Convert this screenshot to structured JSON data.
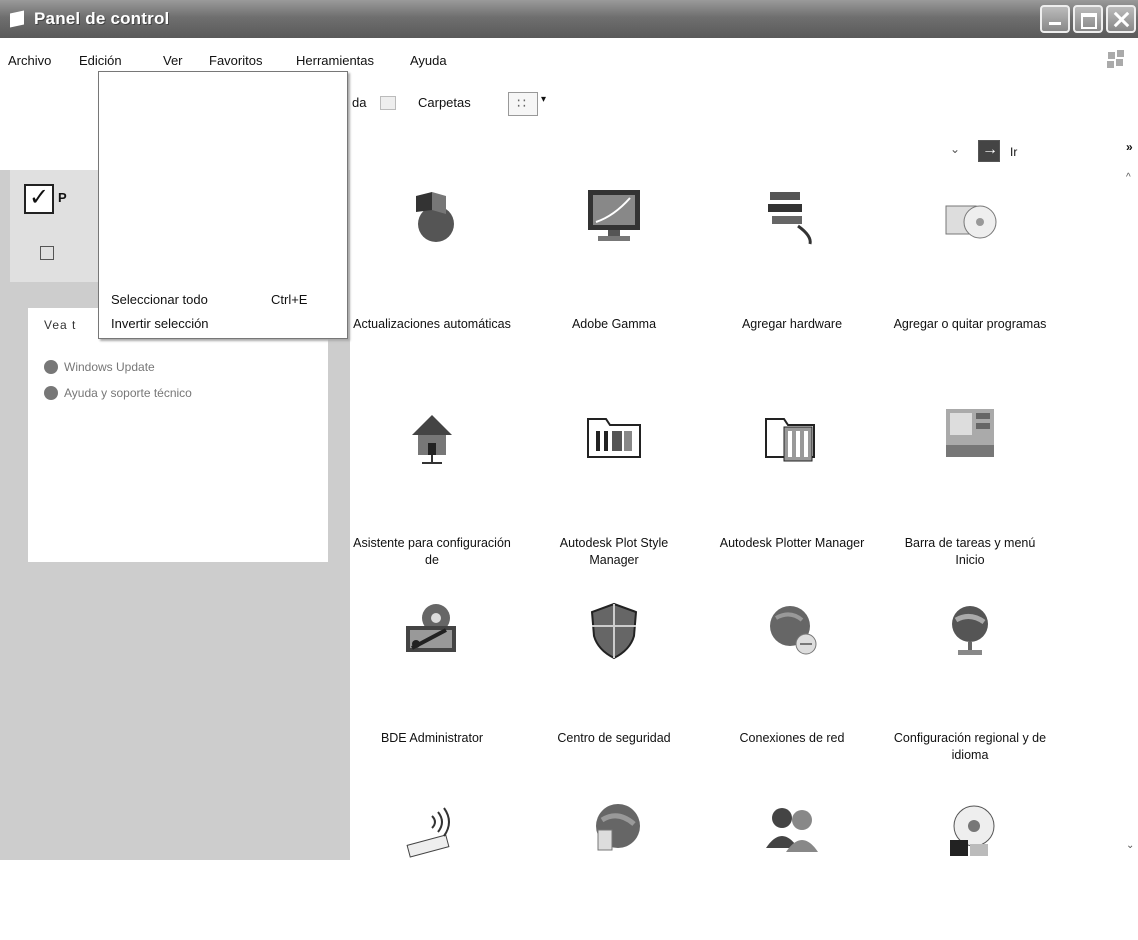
{
  "window": {
    "title": "Panel de control"
  },
  "menubar": [
    "Archivo",
    "Edición",
    "Ver",
    "Favoritos",
    "Herramientas",
    "Ayuda"
  ],
  "toolbar": {
    "search_fragment": "da",
    "folders_label": "Carpetas",
    "go_label": "Ir",
    "more_chevron": "»"
  },
  "dropdown": {
    "items": [
      {
        "label": "Seleccionar todo",
        "shortcut": "Ctrl+E"
      },
      {
        "label": "Invertir selección"
      }
    ]
  },
  "left_panel": {
    "see_also_fragment": "Vea t",
    "header_letter": "P",
    "links": [
      "Windows Update",
      "Ayuda y soporte técnico"
    ]
  },
  "icons": [
    {
      "label": "Actualizaciones automáticas",
      "icon": "windows-update-globe-icon"
    },
    {
      "label": "Adobe Gamma",
      "icon": "adobe-gamma-monitor-icon"
    },
    {
      "label": "Agregar hardware",
      "icon": "add-hardware-icon"
    },
    {
      "label": "Agregar o quitar programas",
      "icon": "add-remove-programs-icon"
    },
    {
      "label": "Asistente para configuración de",
      "icon": "network-setup-house-icon"
    },
    {
      "label": "Autodesk Plot Style Manager",
      "icon": "plot-style-folder-icon"
    },
    {
      "label": "Autodesk Plotter Manager",
      "icon": "plotter-folder-icon"
    },
    {
      "label": "Barra de tareas y menú Inicio",
      "icon": "taskbar-start-menu-icon"
    },
    {
      "label": "BDE Administrator",
      "icon": "bde-gear-wrench-icon"
    },
    {
      "label": "Centro de seguridad",
      "icon": "security-shield-icon"
    },
    {
      "label": "Conexiones de red",
      "icon": "network-connections-globe-icon"
    },
    {
      "label": "Configuración regional y de idioma",
      "icon": "regional-globe-icon"
    },
    {
      "label": "",
      "icon": "wireless-device-icon"
    },
    {
      "label": "",
      "icon": "internet-options-globe-icon"
    },
    {
      "label": "",
      "icon": "user-accounts-icon"
    },
    {
      "label": "",
      "icon": "fonts-cd-icon"
    }
  ]
}
